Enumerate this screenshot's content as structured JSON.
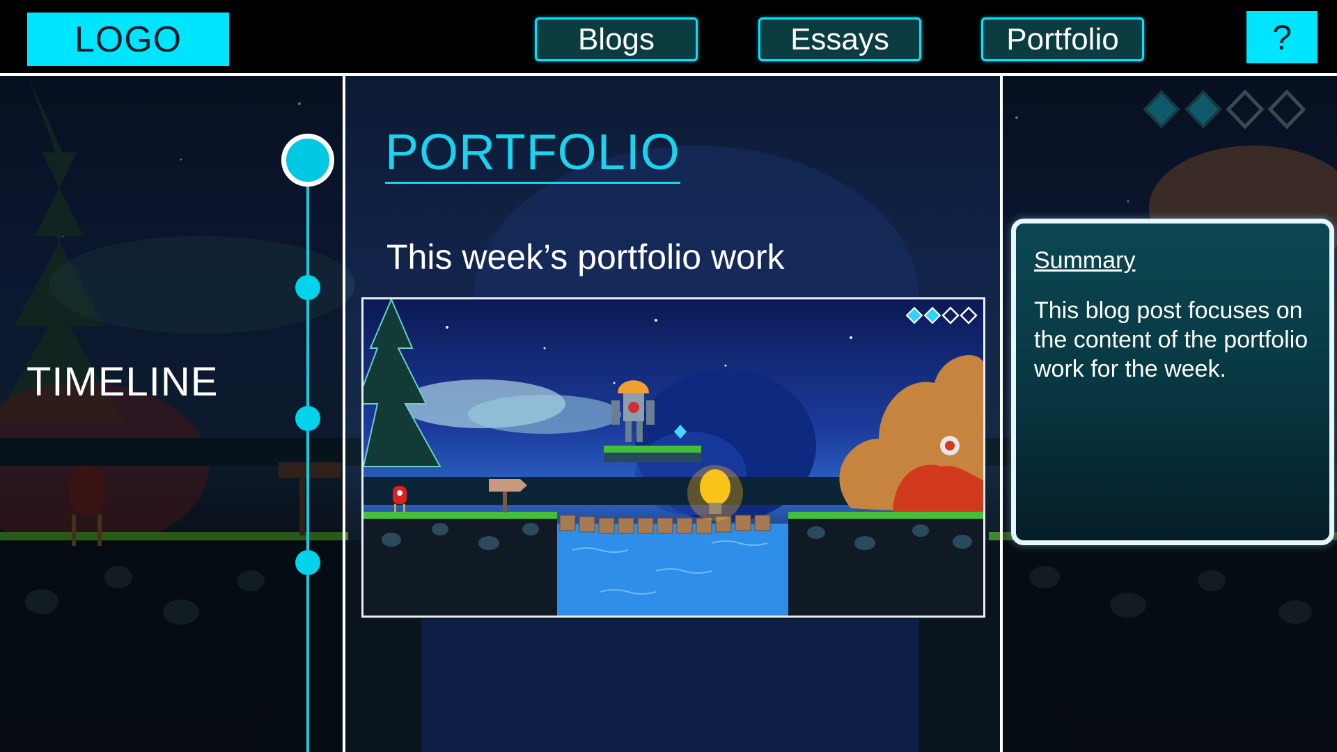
{
  "header": {
    "logo": "LOGO",
    "nav": [
      "Blogs",
      "Essays",
      "Portfolio"
    ],
    "help": "?"
  },
  "timeline": {
    "label": "TIMELINE",
    "node_count": 4,
    "active_index": 0
  },
  "main": {
    "title": "PORTFOLIO",
    "subtitle": "This week’s portfolio work"
  },
  "summary": {
    "heading": "Summary",
    "body": "This blog post focuses on the content of the portfolio work for the week."
  },
  "progress_diamonds": {
    "total": 4,
    "filled": 2
  },
  "colors": {
    "accent": "#00e5ff",
    "nav_fill": "#0b3c40",
    "title": "#19d4ef"
  }
}
